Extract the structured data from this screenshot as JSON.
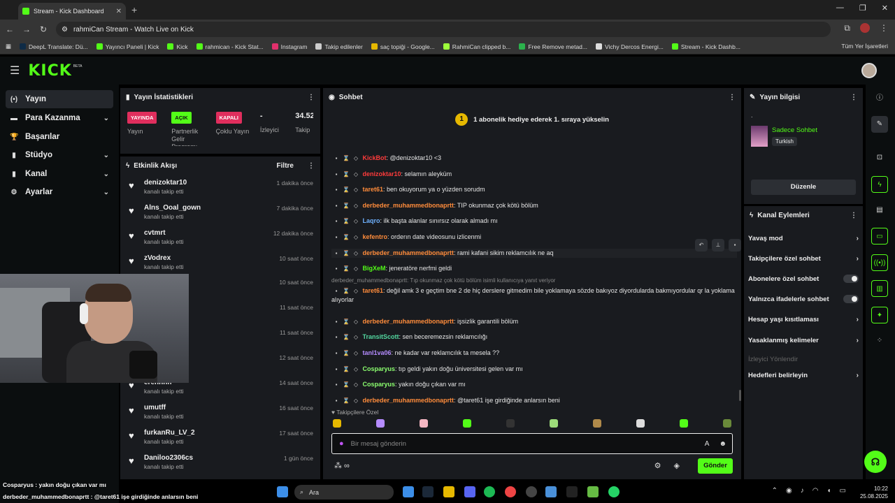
{
  "browser": {
    "tab_title": "Stream - Kick Dashboard",
    "address": "rahmiCan Stream - Watch Live on Kick",
    "bookmarks": [
      "DeepL Translate: Dü...",
      "Yayıncı Paneli | Kick",
      "Kick",
      "rahmican - Kick Stat...",
      "Instagram",
      "Takip edilenler",
      "saç topiği - Google...",
      "RahmiCan clipped b...",
      "Free Remove metad...",
      "Vichy Dercos Energi...",
      "Stream - Kick Dashb..."
    ],
    "all_bookmarks": "Tüm Yer İşaretleri"
  },
  "header": {
    "logo": "KICK",
    "beta": "BETA"
  },
  "nav": [
    {
      "label": "Yayın",
      "icon": "(•)",
      "chev": ""
    },
    {
      "label": "Para Kazanma",
      "icon": "▬",
      "chev": "⌄"
    },
    {
      "label": "Başarılar",
      "icon": "🏆",
      "chev": ""
    },
    {
      "label": "Stüdyo",
      "icon": "▮",
      "chev": "⌄"
    },
    {
      "label": "Kanal",
      "icon": "▮",
      "chev": "⌄"
    },
    {
      "label": "Ayarlar",
      "icon": "⚙",
      "chev": "⌄"
    }
  ],
  "stats": {
    "title": "Yayın İstatistikleri",
    "items": [
      {
        "badge": "YAYINDA",
        "label": "Yayın"
      },
      {
        "badge": "AÇIK",
        "label": "Partnerlik Gelir Programı"
      },
      {
        "badge": "KAPALI",
        "label": "Çoklu Yayın"
      },
      {
        "value": "-",
        "label": "İzleyici"
      },
      {
        "value": "34.52",
        "label": "Takip"
      }
    ]
  },
  "activity": {
    "title": "Etkinlik Akışı",
    "filter": "Filtre",
    "rows": [
      {
        "name": "denizoktar10",
        "sub": "kanalı takip etti",
        "time": "1 dakika önce"
      },
      {
        "name": "Alns_Ooal_gown",
        "sub": "kanalı takip etti",
        "time": "7 dakika önce"
      },
      {
        "name": "cvtmrt",
        "sub": "kanalı takip etti",
        "time": "12 dakika önce"
      },
      {
        "name": "zVodrex",
        "sub": "kanalı takip etti",
        "time": "10 saat önce"
      },
      {
        "name": "",
        "sub": "",
        "time": "10 saat önce"
      },
      {
        "name": "",
        "sub": "",
        "time": "11 saat önce"
      },
      {
        "name": "",
        "sub": "",
        "time": "11 saat önce"
      },
      {
        "name": "",
        "sub": "",
        "time": "12 saat önce"
      },
      {
        "name": "erenhhh",
        "sub": "kanalı takip etti",
        "time": "14 saat önce"
      },
      {
        "name": "umutff",
        "sub": "kanalı takip etti",
        "time": "16 saat önce"
      },
      {
        "name": "furkanRu_LV_2",
        "sub": "kanalı takip etti",
        "time": "17 saat önce"
      },
      {
        "name": "Daniloo2306cs",
        "sub": "kanalı takip etti",
        "time": "1 gün önce"
      }
    ]
  },
  "chat": {
    "title": "Sohbet",
    "pinned_num": "1",
    "pinned_text": "1 abonelik hediye ederek 1. sıraya yükselin",
    "messages": [
      {
        "user": "KickBot",
        "color": "#ff3b3b",
        "text": ": @denizoktar10 <3"
      },
      {
        "user": "denizoktar10",
        "color": "#ff3b3b",
        "text": ": selamın aleyküm"
      },
      {
        "user": "taret61",
        "color": "#ff8c3b",
        "text": ": ben okuyorum ya o yüzden sorudm"
      },
      {
        "user": "derbeder_muhammedbonaprtt",
        "color": "#ff8c3b",
        "text": ": TIP okunmaz çok kötü bölüm"
      },
      {
        "user": "Laqro",
        "color": "#6fb2ff",
        "text": ": ilk başta alanlar sınırsız olarak almadı mı"
      },
      {
        "user": "kefentro",
        "color": "#ff8c3b",
        "text": ": orderın date videosunu izlicenmi"
      },
      {
        "user": "derbeder_muhammedbonaprtt",
        "color": "#ff8c3b",
        "text": ": rami kafani sikim reklamcılık ne aq"
      },
      {
        "user": "BigXeM",
        "color": "#53fc18",
        "text": ": jeneratöre nerfmi geldi"
      },
      {
        "user": "taret61",
        "color": "#ff8c3b",
        "text": ": değil amk 3 e geçtim bne 2 de hiç derslere gitmedim bile yoklamaya sözde bakıyoz diyordularda bakmıyordular qr la yoklama alıyorlar"
      },
      {
        "user": "derbeder_muhammedbonaprtt",
        "color": "#ff8c3b",
        "text": ": işsizlik garantili bölüm"
      },
      {
        "user": "TransitScott",
        "color": "#53d8a0",
        "text": ": sen beceremezsin reklamcılığı"
      },
      {
        "user": "tanl1va06",
        "color": "#b58cff",
        "text": ": ne kadar var reklamcılık ta mesela ??"
      },
      {
        "user": "Cosparyus",
        "color": "#8cff6f",
        "text": ": tıp geldi yakın doğu üniversitesi gelen var mı"
      },
      {
        "user": "Cosparyus",
        "color": "#8cff6f",
        "text": ": yakın doğu çıkan var mı"
      },
      {
        "user": "derbeder_muhammedbonaprtt",
        "color": "#ff8c3b",
        "text": ": @taret61 işe girdiğinde anlarsın beni"
      }
    ],
    "reply_hint": "derbeder_muhammedbonaprtt: Tıp okunmaz çok kötü bölüm isimli kullanıcıya yanıt veriyor",
    "follower_label": "Takipçilere Özel",
    "input_placeholder": "Bir mesaj gönderin",
    "send_label": "Gönder"
  },
  "stream_info": {
    "title": "Yayın bilgisi",
    "dot": ".",
    "category": "Sadece Sohbet",
    "language": "Turkish",
    "edit_label": "Düzenle"
  },
  "channel_actions": {
    "title": "Kanal Eylemleri",
    "rows": [
      {
        "label": "Yavaş mod",
        "kind": "arrow"
      },
      {
        "label": "Takipçilere özel sohbet",
        "kind": "arrow"
      },
      {
        "label": "Abonelere özel sohbet",
        "kind": "toggle"
      },
      {
        "label": "Yalnızca ifadelerle sohbet",
        "kind": "toggle"
      },
      {
        "label": "Hesap yaşı kısıtlaması",
        "kind": "arrow"
      },
      {
        "label": "Yasaklanmış kelimeler",
        "kind": "arrow"
      },
      {
        "label": "İzleyici Yönlendir",
        "kind": "dim"
      },
      {
        "label": "Hedefleri belirleyin",
        "kind": "arrow"
      }
    ]
  },
  "overlay": {
    "line1": "Cosparyus : yakın doğu çıkan var mı",
    "line2": "derbeder_muhammedbonaprtt : @taret61 işe girdiğinde anlarsın beni"
  },
  "taskbar": {
    "search": "Ara",
    "time": "10:22",
    "date": "25.08.2025",
    "temp": "24°C"
  },
  "colors": {
    "accent": "#53fc18",
    "live": "#e02e5d",
    "panel": "#191b1f",
    "bg": "#0b0e0f"
  }
}
